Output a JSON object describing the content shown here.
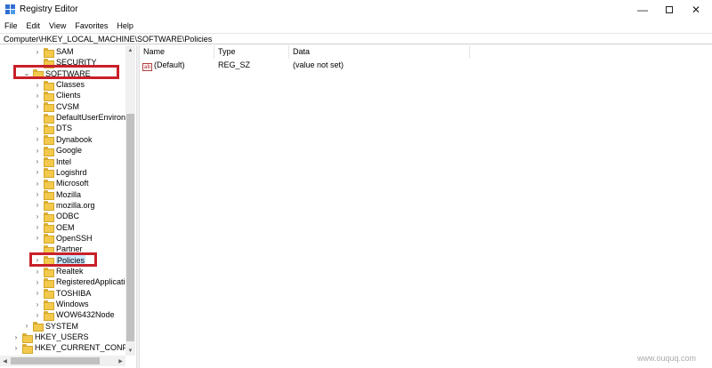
{
  "window": {
    "title": "Registry Editor",
    "minimize_symbol": "—",
    "close_symbol": "✕"
  },
  "menu": [
    "File",
    "Edit",
    "View",
    "Favorites",
    "Help"
  ],
  "address": "Computer\\HKEY_LOCAL_MACHINE\\SOFTWARE\\Policies",
  "tree": {
    "items": [
      {
        "label": "SAM",
        "chevron": "›"
      },
      {
        "label": "SECURITY",
        "chevron": ""
      },
      {
        "label": "SOFTWARE",
        "chevron": "⌄"
      },
      {
        "label": "Classes",
        "chevron": "›"
      },
      {
        "label": "Clients",
        "chevron": "›"
      },
      {
        "label": "CVSM",
        "chevron": "›"
      },
      {
        "label": "DefaultUserEnvironm",
        "chevron": ""
      },
      {
        "label": "DTS",
        "chevron": "›"
      },
      {
        "label": "Dynabook",
        "chevron": "›"
      },
      {
        "label": "Google",
        "chevron": "›"
      },
      {
        "label": "Intel",
        "chevron": "›"
      },
      {
        "label": "Logishrd",
        "chevron": "›"
      },
      {
        "label": "Microsoft",
        "chevron": "›"
      },
      {
        "label": "Mozilla",
        "chevron": "›"
      },
      {
        "label": "mozilla.org",
        "chevron": "›"
      },
      {
        "label": "ODBC",
        "chevron": "›"
      },
      {
        "label": "OEM",
        "chevron": "›"
      },
      {
        "label": "OpenSSH",
        "chevron": "›"
      },
      {
        "label": "Partner",
        "chevron": ""
      },
      {
        "label": "Policies",
        "chevron": "›"
      },
      {
        "label": "Realtek",
        "chevron": "›"
      },
      {
        "label": "RegisteredApplicatio",
        "chevron": "›"
      },
      {
        "label": "TOSHIBA",
        "chevron": "›"
      },
      {
        "label": "Windows",
        "chevron": "›"
      },
      {
        "label": "WOW6432Node",
        "chevron": "›"
      },
      {
        "label": "SYSTEM",
        "chevron": "›"
      },
      {
        "label": "HKEY_USERS",
        "chevron": "›"
      },
      {
        "label": "HKEY_CURRENT_CONFIG",
        "chevron": "›"
      }
    ]
  },
  "list": {
    "columns": [
      "Name",
      "Type",
      "Data"
    ],
    "rows": [
      {
        "icon": "ab",
        "name": "(Default)",
        "type": "REG_SZ",
        "data": "(value not set)"
      }
    ]
  },
  "watermark": "www.ouquq.com",
  "colors": {
    "highlight": "#c8202a",
    "selection": "#cce8ff",
    "folder": "#f2c94c"
  }
}
